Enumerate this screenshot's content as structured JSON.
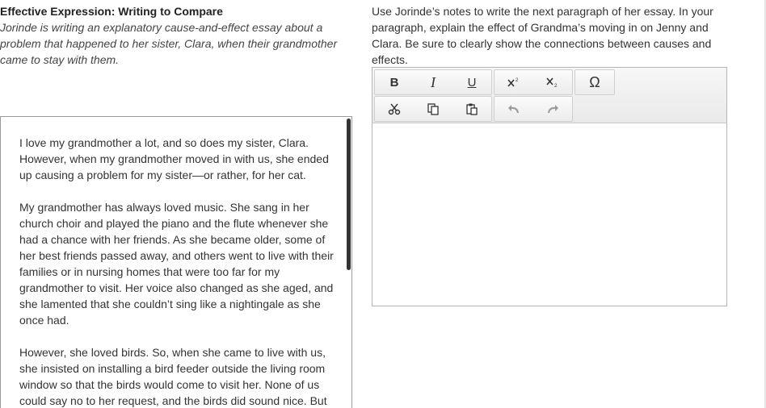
{
  "left": {
    "title": "Effective Expression: Writing to Compare",
    "subtitle": "Jorinde is writing an explanatory cause-and-effect essay about a problem that happened to her sister, Clara, when their grandmother came to stay with them.",
    "passage": [
      "I love my grandmother a lot, and so does my sister, Clara. However, when my grandmother moved in with us, she ended up causing a problem for my sister—or rather, for her cat.",
      "My grandmother has always loved music. She sang in her church choir and played the piano and the flute whenever she had a chance with her friends. As she became older, some of her best friends passed away, and others went to live with their families or in nursing homes that were too far for my grandmother to visit. Her voice also changed as she aged, and she lamented that she couldn’t sing like a nightingale as she once had.",
      "However, she loved birds. So, when she came to live with us, she insisted on installing a bird feeder outside the living room window so that the birds would come to visit her. None of us could say no to her request, and the birds did sound nice. But"
    ]
  },
  "right": {
    "prompt": "Use Jorinde’s notes to write the next paragraph of her essay. In your paragraph, explain the effect of Grandma’s moving in on Jenny and Clara. Be sure to clearly show the connections between causes and effects.",
    "editor_text": ""
  },
  "toolbar": {
    "bold": "B",
    "italic": "I",
    "underline": "U",
    "special_char": "Ω",
    "icons": [
      "bold-icon",
      "italic-icon",
      "underline-icon",
      "superscript-icon",
      "subscript-icon",
      "omega-icon",
      "cut-icon",
      "copy-icon",
      "paste-icon",
      "undo-icon",
      "redo-icon"
    ]
  }
}
